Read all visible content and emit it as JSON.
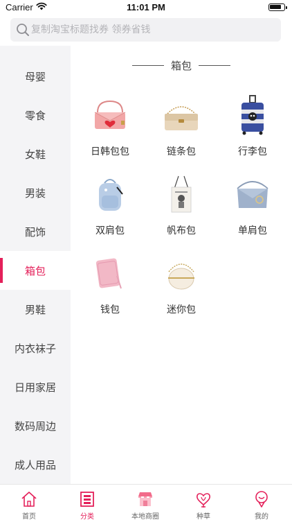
{
  "status": {
    "carrier": "Carrier",
    "time": "11:01 PM",
    "battery_level": 0.85
  },
  "search": {
    "placeholder": "复制淘宝标题找券 领券省钱"
  },
  "sidebar": {
    "items": [
      {
        "label": "母婴"
      },
      {
        "label": "零食"
      },
      {
        "label": "女鞋"
      },
      {
        "label": "男装"
      },
      {
        "label": "配饰"
      },
      {
        "label": "箱包",
        "active": true
      },
      {
        "label": "男鞋"
      },
      {
        "label": "内衣袜子"
      },
      {
        "label": "日用家居"
      },
      {
        "label": "数码周边"
      },
      {
        "label": "成人用品"
      }
    ]
  },
  "section": {
    "title": "箱包",
    "categories": [
      {
        "label": "日韩包包",
        "icon": "pink-handbag-icon"
      },
      {
        "label": "链条包",
        "icon": "chain-bag-icon"
      },
      {
        "label": "行李包",
        "icon": "luggage-icon"
      },
      {
        "label": "双肩包",
        "icon": "backpack-icon"
      },
      {
        "label": "帆布包",
        "icon": "canvas-tote-icon"
      },
      {
        "label": "单肩包",
        "icon": "shoulder-bag-icon"
      },
      {
        "label": "钱包",
        "icon": "wallet-icon"
      },
      {
        "label": "迷你包",
        "icon": "mini-bag-icon"
      }
    ]
  },
  "tabbar": {
    "tabs": [
      {
        "label": "首页",
        "icon": "home-icon"
      },
      {
        "label": "分类",
        "icon": "category-icon",
        "active": true
      },
      {
        "label": "本地商圈",
        "icon": "store-icon"
      },
      {
        "label": "种草",
        "icon": "heart-sprout-icon"
      },
      {
        "label": "我的",
        "icon": "profile-icon"
      }
    ]
  },
  "colors": {
    "accent": "#e4205a",
    "sidebar_bg": "#f4f4f6",
    "search_bg": "#f1f1f3"
  }
}
